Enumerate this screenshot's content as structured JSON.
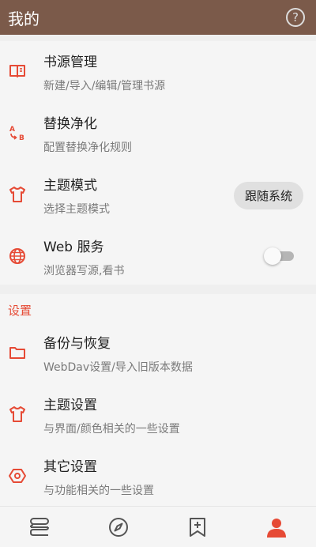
{
  "appbar": {
    "title": "我的",
    "help_glyph": "?"
  },
  "items_top": [
    {
      "title": "书源管理",
      "sub": "新建/导入/编辑/管理书源",
      "icon": "book-open-icon"
    },
    {
      "title": "替换净化",
      "sub": "配置替换净化规则",
      "icon": "replace-ab-icon"
    },
    {
      "title": "主题模式",
      "sub": "选择主题模式",
      "icon": "tshirt-icon",
      "value": "跟随系统"
    },
    {
      "title": "Web 服务",
      "sub": "浏览器写源,看书",
      "icon": "globe-icon",
      "toggle_on": false
    }
  ],
  "settings": {
    "header": "设置",
    "items": [
      {
        "title": "备份与恢复",
        "sub": "WebDav设置/导入旧版本数据",
        "icon": "folder-icon"
      },
      {
        "title": "主题设置",
        "sub": "与界面/颜色相关的一些设置",
        "icon": "tshirt-icon"
      },
      {
        "title": "其它设置",
        "sub": "与功能相关的一些设置",
        "icon": "hexagon-settings-icon"
      }
    ]
  },
  "bottom_nav": [
    {
      "name": "bookshelf-tab",
      "icon": "bookshelf-icon",
      "active": false
    },
    {
      "name": "explore-tab",
      "icon": "compass-icon",
      "active": false
    },
    {
      "name": "rss-tab",
      "icon": "bookmark-add-icon",
      "active": false
    },
    {
      "name": "my-tab",
      "icon": "person-icon",
      "active": true
    }
  ],
  "colors": {
    "appbar": "#7b5a4a",
    "accent": "#e64a35",
    "icon_inactive": "#555555"
  }
}
